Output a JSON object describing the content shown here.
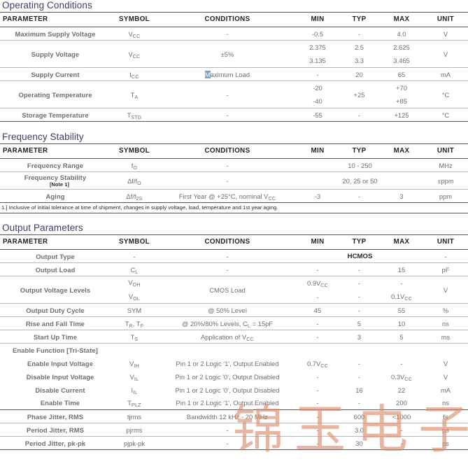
{
  "watermark": {
    "chars": [
      "锦",
      "玉",
      "电",
      "子"
    ],
    "color": "#d98b6a"
  },
  "columns": [
    "PARAMETER",
    "SYMBOL",
    "CONDITIONS",
    "MIN",
    "TYP",
    "MAX",
    "UNIT"
  ],
  "sections": [
    {
      "title": "Operating Conditions",
      "rows": [
        {
          "param": "Maximum Supply Voltage",
          "symbol": "VCC",
          "conditions": "-",
          "min": "-0.5",
          "typ": "-",
          "max": "4.0",
          "unit": "V"
        },
        {
          "param": "Supply Voltage",
          "symbol": "VCC",
          "conditions": "±5%",
          "min": [
            "2.375",
            "3.135"
          ],
          "typ": [
            "2.5",
            "3.3"
          ],
          "max": [
            "2.625",
            "3.465"
          ],
          "unit": "V"
        },
        {
          "param": "Supply Current",
          "symbol": "ICC",
          "conditions": "Maximum Load",
          "min": "-",
          "typ": "20",
          "max": "65",
          "unit": "mA"
        },
        {
          "param": "Operating Temperature",
          "symbol": "TA",
          "conditions": "-",
          "min": [
            "-20",
            "-40"
          ],
          "typ": "+25",
          "max": [
            "+70",
            "+85"
          ],
          "unit": "°C"
        },
        {
          "param": "Storage Temperature",
          "symbol": "TSTG",
          "conditions": "-",
          "min": "-55",
          "typ": "-",
          "max": "+125",
          "unit": "°C"
        }
      ]
    },
    {
      "title": "Frequency Stability",
      "rows": [
        {
          "param": "Frequency Range",
          "symbol": "fO",
          "conditions": "-",
          "typ_span": "10 - 250",
          "unit": "MHz"
        },
        {
          "param": "Frequency Stability",
          "note": "[Note 1]",
          "symbol": "Δf/fO",
          "conditions": "-",
          "typ_span": "20, 25 or 50",
          "unit": "±ppm"
        },
        {
          "param": "Aging",
          "symbol": "Δf/f2S",
          "conditions": "First Year @ +25°C, nominal VCC",
          "min": "-3",
          "typ": "-",
          "max": "3",
          "unit": "ppm"
        }
      ],
      "footnote": "1.]  Inclusive of initial tolerance at time of shipment, changes in supply voltage, load, temperature and 1st year aging."
    },
    {
      "title": "Output Parameters",
      "rows": [
        {
          "param": "Output Type",
          "symbol": "-",
          "conditions": "-",
          "typ_span": "HCMOS",
          "unit": "-"
        },
        {
          "param": "Output Load",
          "symbol": "CL",
          "conditions": "-",
          "min": "-",
          "typ": "-",
          "max": "15",
          "unit": "pF"
        },
        {
          "param": "Output Voltage Levels",
          "symbol": [
            "VOH",
            "VOL"
          ],
          "conditions": "CMOS Load",
          "min": [
            "0.9VCC",
            "-"
          ],
          "typ": [
            "-",
            "-"
          ],
          "max": [
            "-",
            "0.1VCC"
          ],
          "unit": "V"
        },
        {
          "param": "Output Duty Cycle",
          "symbol": "SYM",
          "conditions": "@ 50% Level",
          "min": "45",
          "typ": "-",
          "max": "55",
          "unit": "%"
        },
        {
          "param": "Rise and Fall Time",
          "symbol": "TR, TF",
          "conditions": "@ 20%/80% Levels, CL = 15pF",
          "min": "-",
          "typ": "5",
          "max": "10",
          "unit": "ns"
        },
        {
          "param": "Start Up Time",
          "symbol": "TS",
          "conditions": "Application of VCC",
          "min": "-",
          "typ": "3",
          "max": "5",
          "unit": "ms"
        },
        {
          "param": "Enable Function [Tri-State]",
          "group": true
        },
        {
          "param": "Enable Input Voltage",
          "indent": true,
          "symbol": "VIH",
          "conditions": "Pin 1 or 2 Logic '1', Output Enabled",
          "min": "0.7VCC",
          "typ": "-",
          "max": "-",
          "unit": "V"
        },
        {
          "param": "Disable Input Voltage",
          "indent": true,
          "symbol": "VIL",
          "conditions": "Pin 1 or 2 Logic '0', Output Disabled",
          "min": "-",
          "typ": "-",
          "max": "0.3VCC",
          "unit": "V"
        },
        {
          "param": "Disable Current",
          "indent": true,
          "symbol": "IIL",
          "conditions": "Pin 1 or 2 Logic '0', Output Disabled",
          "min": "-",
          "typ": "16",
          "max": "22",
          "unit": "mA"
        },
        {
          "param": "Enable Time",
          "indent": true,
          "symbol": "TPLZ",
          "conditions": "Pin 1 or 2 Logic '1', Output Enabled",
          "min": "-",
          "typ": "-",
          "max": "200",
          "unit": "ns",
          "thickbottom": true
        },
        {
          "param": "Phase Jitter, RMS",
          "symbol": "tjrms",
          "conditions": "Bandwidth 12 kHz - 20 MHz",
          "min": "-",
          "typ": "600",
          "max": "<1000",
          "unit": "fs"
        },
        {
          "param": "Period Jitter, RMS",
          "symbol": "pjrms",
          "conditions": "-",
          "min": "-",
          "typ": "3.0",
          "max": "-",
          "unit": "ps"
        },
        {
          "param": "Period Jitter, pk-pk",
          "symbol": "pjpk-pk",
          "conditions": "-",
          "min": "-",
          "typ": "30",
          "max": "-",
          "unit": "ps"
        }
      ]
    }
  ]
}
